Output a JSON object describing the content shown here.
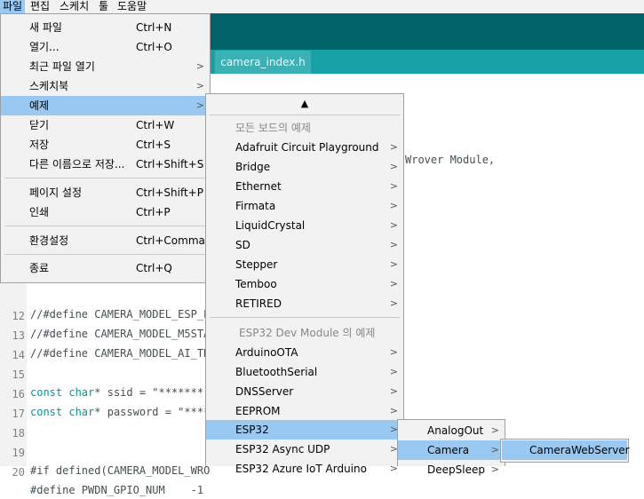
{
  "menubar": [
    "파일",
    "편집",
    "스케치",
    "툴",
    "도움말"
  ],
  "editor": {
    "tab_label": "camera_index.h",
    "partial_text": "Wrover Module,",
    "lines": [
      {
        "n": "",
        "code": "//#define CAMERA_MODEL_ESP_EYE"
      },
      {
        "n": "12",
        "code": "//#define CAMERA_MODEL_M5STA"
      },
      {
        "n": "13",
        "code": "//#define CAMERA_MODEL_AI_TH"
      },
      {
        "n": "14",
        "code": ""
      },
      {
        "n": "15",
        "code_kw1": "const",
        "code_kw2": "char",
        "code_rest": "* ssid = \"*******"
      },
      {
        "n": "16",
        "code_kw1": "const",
        "code_kw2": "char",
        "code_rest": "* password = \"****"
      },
      {
        "n": "17",
        "code": ""
      },
      {
        "n": "18",
        "code": ""
      },
      {
        "n": "19",
        "code": "#if defined(CAMERA_MODEL_WRO"
      },
      {
        "n": "20",
        "code": "#define PWDN_GPIO_NUM    -1"
      }
    ]
  },
  "file_menu": {
    "items": [
      {
        "label": "새 파일",
        "accel": "Ctrl+N"
      },
      {
        "label": "열기...",
        "accel": "Ctrl+O"
      },
      {
        "label": "최근 파일 열기",
        "submenu": true
      },
      {
        "label": "스케치북",
        "submenu": true
      },
      {
        "label": "예제",
        "submenu": true,
        "highlighted": true
      },
      {
        "label": "닫기",
        "accel": "Ctrl+W"
      },
      {
        "label": "저장",
        "accel": "Ctrl+S"
      },
      {
        "label": "다른 이름으로 저장...",
        "accel": "Ctrl+Shift+S"
      },
      {
        "label": "페이지 설정",
        "accel": "Ctrl+Shift+P"
      },
      {
        "label": "인쇄",
        "accel": "Ctrl+P"
      },
      {
        "label": "환경설정",
        "accel": "Ctrl+Comma"
      },
      {
        "label": "종료",
        "accel": "Ctrl+Q"
      }
    ]
  },
  "examples_menu": {
    "scroll_up": "▲",
    "all_boards_header": "모든 보드의 예제",
    "board_items": [
      "Adafruit Circuit Playground",
      "Bridge",
      "Ethernet",
      "Firmata",
      "LiquidCrystal",
      "SD",
      "Stepper",
      "Temboo",
      "RETIRED"
    ],
    "esp32_header": "ESP32 Dev Module 의 예제",
    "esp32_items": [
      "ArduinoOTA",
      "BluetoothSerial",
      "DNSServer",
      "EEPROM",
      "ESP32",
      "ESP32 Async UDP",
      "ESP32 Azure IoT Arduino"
    ]
  },
  "esp32_menu": {
    "items": [
      "AnalogOut",
      "Camera",
      "DeepSleep"
    ]
  },
  "camera_menu": {
    "items": [
      "CameraWebServer"
    ]
  },
  "icons": {
    "submenu_arrow": ">",
    "scroll_up": "up-triangle"
  },
  "colors": {
    "toolbar": "#006468",
    "tab_band": "#17a1a5",
    "highlight": "#99c9f2",
    "menu_bg": "#f2f2f2"
  }
}
